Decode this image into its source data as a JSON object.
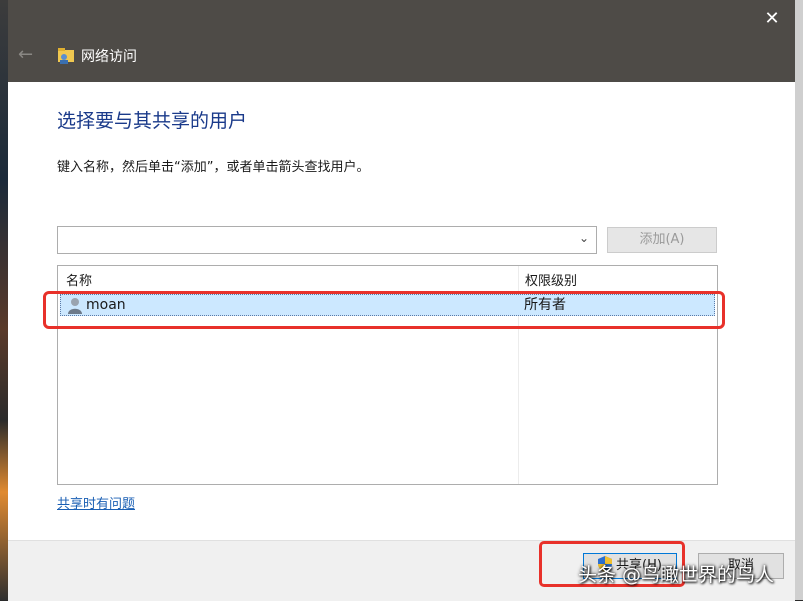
{
  "window": {
    "title": "网络访问",
    "close_glyph": "✕",
    "back_glyph": "←"
  },
  "main": {
    "heading": "选择要与其共享的用户",
    "instruction": "键入名称，然后单击“添加”，或者单击箭头查找用户。"
  },
  "user_input": {
    "value": "",
    "placeholder": "",
    "dropdown_glyph": "⌄"
  },
  "add_button": {
    "label": "添加(A)",
    "enabled": false
  },
  "user_list": {
    "columns": [
      "名称",
      "权限级别"
    ],
    "rows": [
      {
        "name": "moan",
        "permission": "所有者",
        "icon": "user-icon",
        "selected": true
      }
    ]
  },
  "help_link": "共享时有问题",
  "footer": {
    "share_label": "共享(H)",
    "share_icon": "uac-shield-icon",
    "cancel_label": "取消"
  },
  "annotations": {
    "highlight_color": "#e8312a"
  },
  "watermark": "头条 @鸟瞰世界的鸟人",
  "colors": {
    "titlebar": "#4e4b47",
    "heading": "#1a3a8a",
    "link": "#1a5fb4",
    "selection": "#cce8ff"
  }
}
